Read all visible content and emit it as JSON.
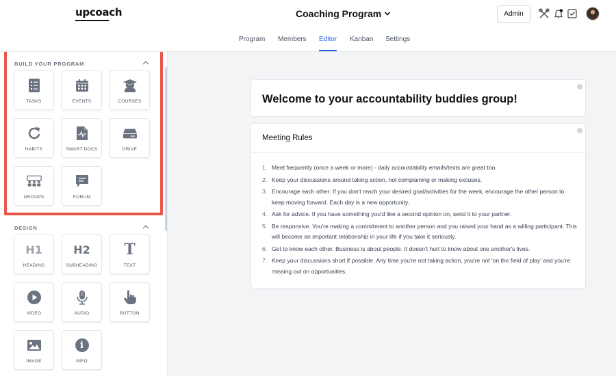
{
  "header": {
    "logo": "upcoach",
    "program_title": "Coaching Program",
    "admin_label": "Admin",
    "icons": [
      "tools-icon",
      "bell-icon",
      "checkbox-icon",
      "avatar"
    ]
  },
  "tabs": [
    {
      "label": "Program",
      "active": false
    },
    {
      "label": "Members",
      "active": false
    },
    {
      "label": "Editor",
      "active": true
    },
    {
      "label": "Kanban",
      "active": false
    },
    {
      "label": "Settings",
      "active": false
    }
  ],
  "sidebar": {
    "build": {
      "title": "BUILD YOUR PROGRAM",
      "items": [
        {
          "label": "TASKS",
          "icon": "tasks-icon"
        },
        {
          "label": "EVENTS",
          "icon": "calendar-icon"
        },
        {
          "label": "COURSES",
          "icon": "graduation-cap-icon"
        },
        {
          "label": "HABITS",
          "icon": "redo-icon"
        },
        {
          "label": "SMART DOCS",
          "icon": "smart-doc-icon"
        },
        {
          "label": "DRIVE",
          "icon": "drive-icon"
        },
        {
          "label": "GROUPS",
          "icon": "groups-icon"
        },
        {
          "label": "FORUM",
          "icon": "chat-icon"
        }
      ]
    },
    "design": {
      "title": "DESIGN",
      "items": [
        {
          "label": "HEADING",
          "icon": "h1-icon",
          "glyph": "H1"
        },
        {
          "label": "SUBHEADING",
          "icon": "h2-icon",
          "glyph": "H2"
        },
        {
          "label": "TEXT",
          "icon": "text-icon",
          "glyph": "T"
        },
        {
          "label": "VIDEO",
          "icon": "play-icon"
        },
        {
          "label": "AUDIO",
          "icon": "microphone-icon"
        },
        {
          "label": "BUTTON",
          "icon": "pointer-hand-icon"
        },
        {
          "label": "IMAGE",
          "icon": "image-icon"
        },
        {
          "label": "INFO",
          "icon": "info-icon",
          "glyph": "i"
        }
      ]
    }
  },
  "main": {
    "welcome_title": "Welcome to your accountability buddies group!",
    "rules_title": "Meeting Rules",
    "rules": [
      {
        "num": "1.",
        "text": "Meet frequently (once a week or more) - daily accountability emails/texts are great too."
      },
      {
        "num": "2.",
        "text": "Keep your discussions around taking action, not complaining or making excuses."
      },
      {
        "num": "3.",
        "text": "Encourage each other. If you don't reach your desired goal/activities for the week, encourage the other person to keep moving forward. Each day is a new opportunity."
      },
      {
        "num": "4.",
        "text": "Ask for advice. If you have something you'd like a second opinion on, send it to your partner."
      },
      {
        "num": "5.",
        "text": "Be responsive. You're making a commitment to another person and you raised your hand as a willing participant. This will become an important relationship in your life if you take it seriously."
      },
      {
        "num": "6.",
        "text": "Get to know each other. Business is about people. It doesn't hurt to know about one another's lives."
      },
      {
        "num": "7.",
        "text": "Keep your discussions short if possible. Any time you're not taking action, you're not 'on the field of play' and you're missing out on opportunities."
      }
    ]
  },
  "colors": {
    "accent": "#2563eb",
    "highlight": "#e8574a",
    "icon_gray": "#6b7280"
  }
}
